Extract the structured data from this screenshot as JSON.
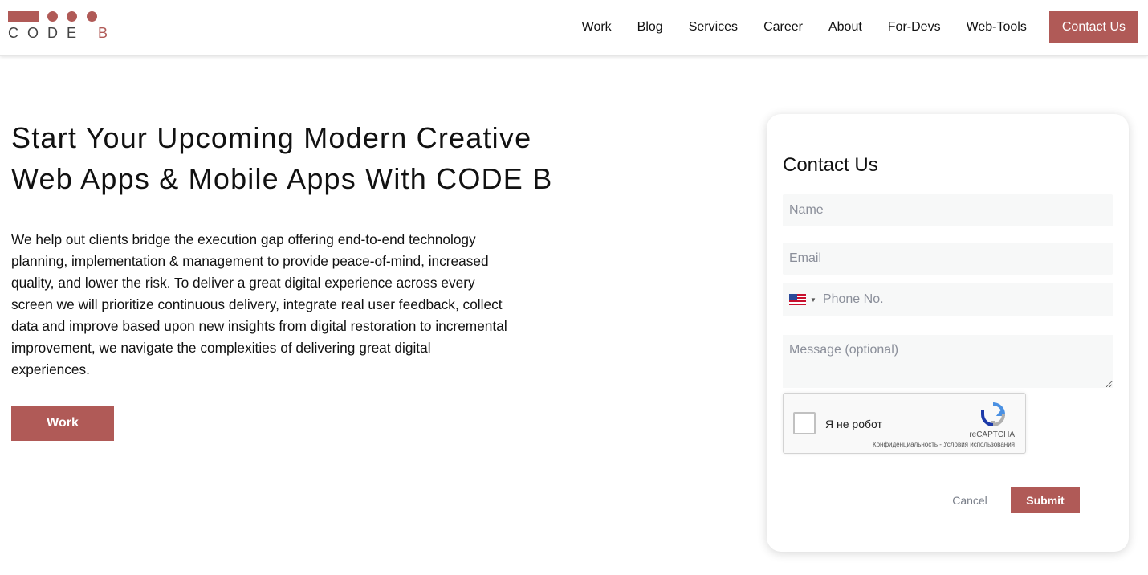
{
  "logo": {
    "word": "CODE ",
    "word_b": "B"
  },
  "nav": {
    "items": [
      {
        "label": "Work"
      },
      {
        "label": "Blog"
      },
      {
        "label": "Services"
      },
      {
        "label": "Career"
      },
      {
        "label": "About"
      },
      {
        "label": "For-Devs"
      },
      {
        "label": "Web-Tools"
      }
    ],
    "contact_label": "Contact Us"
  },
  "hero": {
    "title": "Start Your Upcoming Modern Creative Web Apps & Mobile Apps With CODE B",
    "description": "We help out clients bridge the execution gap offering end-to-end technology planning, implementation & management to provide peace-of-mind, increased quality, and lower the risk. To deliver a great digital experience across every screen we will prioritize continuous delivery, integrate real user feedback, collect data and improve based upon new insights from digital restoration to incremental improvement, we navigate the complexities of delivering great digital experiences.",
    "button_label": "Work"
  },
  "form": {
    "title": "Contact Us",
    "name_placeholder": "Name",
    "email_placeholder": "Email",
    "phone_placeholder": "Phone No.",
    "message_placeholder": "Message (optional)",
    "recaptcha": {
      "label": "Я не робот",
      "brand": "reCAPTCHA",
      "links": "Конфиденциальность - Условия использования"
    },
    "cancel_label": "Cancel",
    "submit_label": "Submit"
  },
  "colors": {
    "accent": "#b05a57"
  }
}
